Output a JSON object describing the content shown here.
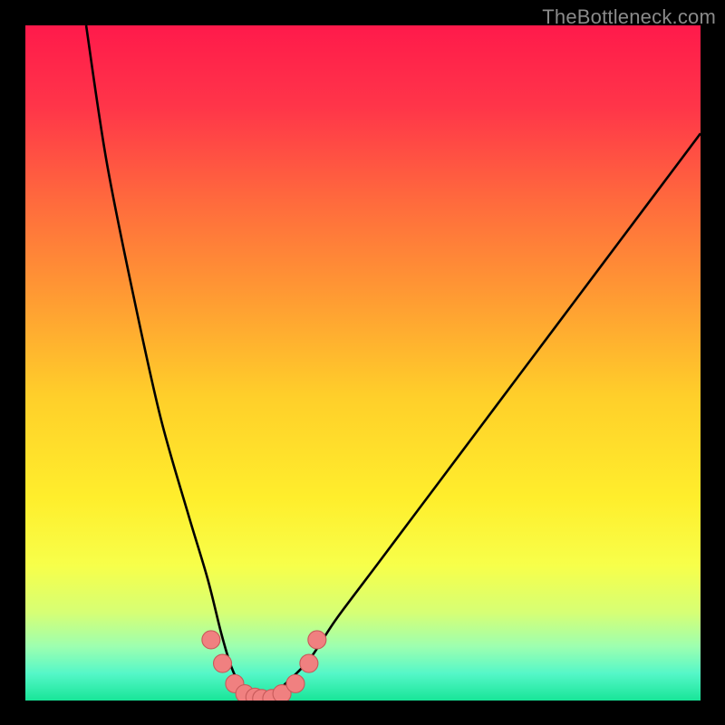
{
  "watermark": "TheBottleneck.com",
  "gradient_stops": [
    {
      "offset": 0,
      "color": "#ff1a4b"
    },
    {
      "offset": 0.12,
      "color": "#ff3549"
    },
    {
      "offset": 0.26,
      "color": "#ff6a3d"
    },
    {
      "offset": 0.4,
      "color": "#ff9a33"
    },
    {
      "offset": 0.55,
      "color": "#ffcf2a"
    },
    {
      "offset": 0.7,
      "color": "#ffee2c"
    },
    {
      "offset": 0.8,
      "color": "#f7ff4a"
    },
    {
      "offset": 0.87,
      "color": "#d6ff75"
    },
    {
      "offset": 0.92,
      "color": "#9dffb0"
    },
    {
      "offset": 0.96,
      "color": "#55f7c8"
    },
    {
      "offset": 1.0,
      "color": "#18e598"
    }
  ],
  "chart_data": {
    "type": "line",
    "title": "",
    "xlabel": "",
    "ylabel": "",
    "xlim": [
      0,
      100
    ],
    "ylim": [
      0,
      100
    ],
    "series": [
      {
        "name": "curve",
        "x": [
          9,
          12,
          16,
          20,
          24,
          27,
          29,
          30.5,
          32,
          34,
          36,
          38,
          42,
          46,
          52,
          58,
          64,
          70,
          76,
          82,
          88,
          94,
          100
        ],
        "y": [
          100,
          80,
          60,
          42,
          28,
          18,
          10,
          5,
          2,
          0,
          0,
          2,
          6,
          12,
          20,
          28,
          36,
          44,
          52,
          60,
          68,
          76,
          84
        ]
      }
    ],
    "markers": {
      "name": "highlight-points",
      "x": [
        27.5,
        29.2,
        31,
        32.5,
        34,
        35,
        36.5,
        38,
        40,
        42,
        43.2
      ],
      "y": [
        9,
        5.5,
        2.5,
        1,
        0.5,
        0.3,
        0.3,
        1,
        2.5,
        5.5,
        9
      ]
    },
    "marker_style": {
      "fill": "#f08080",
      "stroke": "#c85a5a",
      "r": 10
    }
  }
}
